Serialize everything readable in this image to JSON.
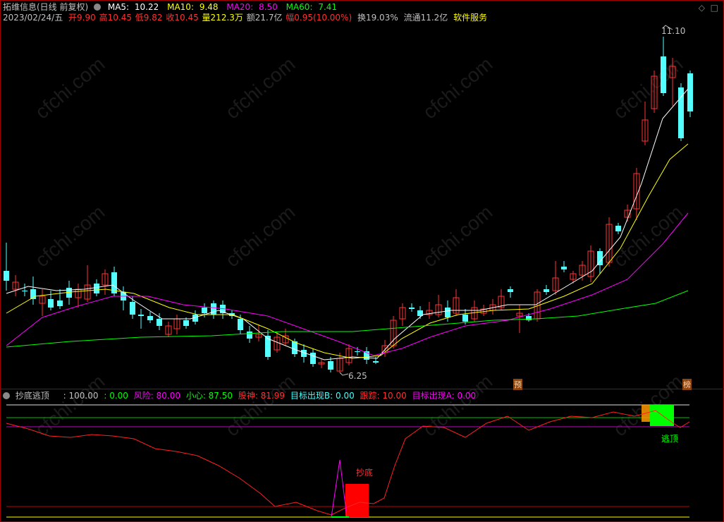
{
  "title_bar": {
    "stock": "拓维信息(日线 前复权)",
    "ma": [
      {
        "label": "MA5:",
        "value": "10.22",
        "color": "#ffffff"
      },
      {
        "label": "MA10:",
        "value": "9.48",
        "color": "#ffff00"
      },
      {
        "label": "MA20:",
        "value": "8.50",
        "color": "#ff00ff"
      },
      {
        "label": "MA60:",
        "value": "7.41",
        "color": "#00ff00"
      }
    ]
  },
  "info_bar": {
    "date": "2023/02/24/五",
    "open": "开9.90",
    "high": "高10.45",
    "low": "低9.82",
    "close": "收10.45",
    "volume": "量212.3万",
    "amount": "额21.7亿",
    "change": "幅0.95(10.00%)",
    "turnover": "换19.03%",
    "float": "流通11.2亿",
    "industry": "软件服务"
  },
  "price_labels": {
    "high": "11.10",
    "low": "6.25"
  },
  "markers": {
    "yu": "预",
    "bang": "榜"
  },
  "indicator": {
    "name": "抄底逃顶",
    "items": [
      {
        "text": ": 100.00",
        "color": "#c0c0c0"
      },
      {
        "text": ": 0.00",
        "color": "#00ff00"
      },
      {
        "text": "风险: 80.00",
        "color": "#ff00ff"
      },
      {
        "text": "小心: 87.50",
        "color": "#00ff00"
      },
      {
        "text": "股神: 81.99",
        "color": "#ff3030"
      },
      {
        "text": "目标出现B: 0.00",
        "color": "#40ffff"
      },
      {
        "text": "跟踪: 10.00",
        "color": "#ff3030"
      },
      {
        "text": "目标出现A: 0.00",
        "color": "#ff00ff"
      }
    ],
    "buy_label": "抄底",
    "sell_label": "逃顶"
  },
  "watermark": "cfchi.com",
  "colors": {
    "up": "#ff3232",
    "down": "#54ffff",
    "ma5": "#ffffff",
    "ma10": "#ffff00",
    "ma20": "#ff00ff",
    "ma60": "#00ff00"
  }
}
